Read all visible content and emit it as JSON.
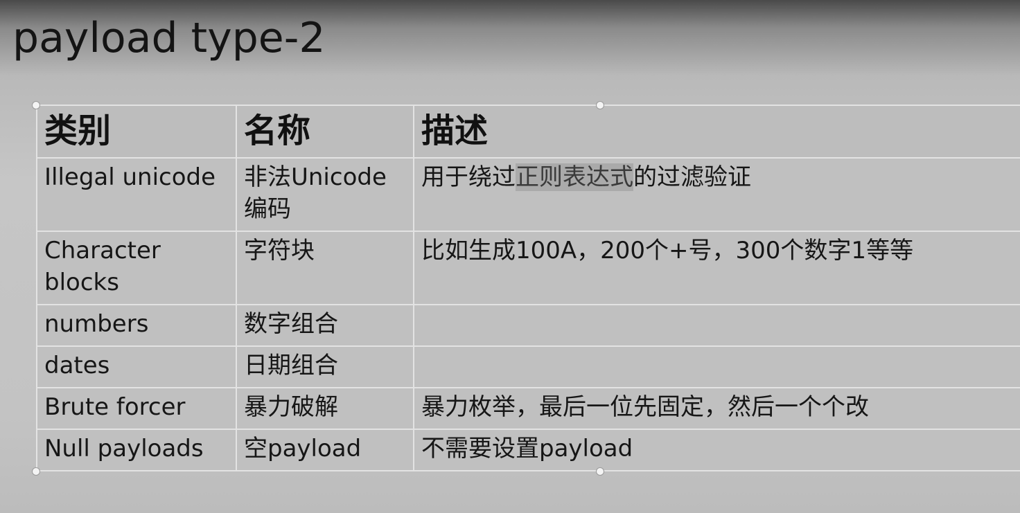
{
  "slide": {
    "title": "payload type-2"
  },
  "table": {
    "headers": {
      "category": "类别",
      "name": "名称",
      "description": "描述"
    },
    "rows": [
      {
        "category": "Illegal unicode",
        "name": "非法Unicode编码",
        "description_before": "用于绕过",
        "description_highlight": "正则表达式",
        "description_after": "的过滤验证"
      },
      {
        "category": "Character blocks",
        "name": "字符块",
        "description": "比如生成100A，200个+号，300个数字1等等"
      },
      {
        "category": "numbers",
        "name": "数字组合",
        "description": ""
      },
      {
        "category": "dates",
        "name": "日期组合",
        "description": ""
      },
      {
        "category": "Brute forcer",
        "name": "暴力破解",
        "description": "暴力枚举，最后一位先固定，然后一个个改"
      },
      {
        "category": "Null payloads",
        "name": "空payload",
        "description": "不需要设置payload"
      }
    ]
  },
  "colors": {
    "table_border": "#e3e3e3",
    "cell_background": "#c0c0c0",
    "highlight_background": "#aaaaaa"
  }
}
